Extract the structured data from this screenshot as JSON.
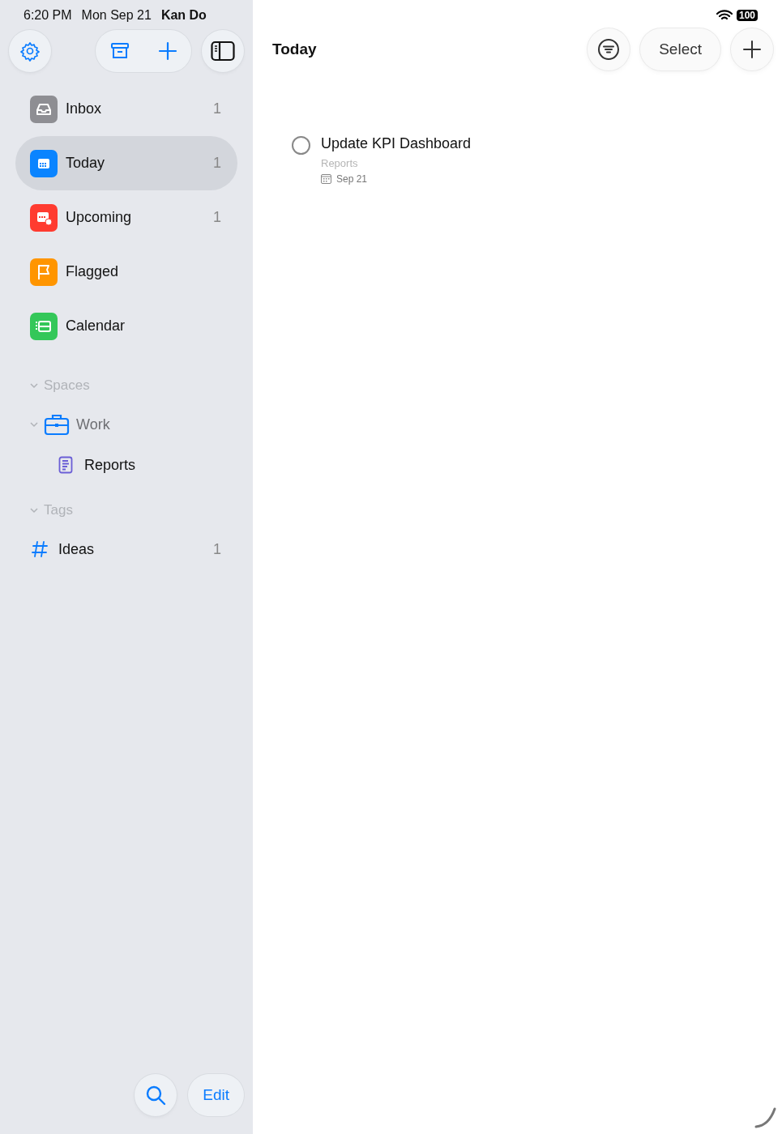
{
  "status_bar": {
    "time": "6:20 PM",
    "date": "Mon Sep 21",
    "app": "Kan Do",
    "battery": "100"
  },
  "sidebar": {
    "smart_lists": [
      {
        "kind": "inbox",
        "label": "Inbox",
        "count": "1",
        "color": "#8e8e93",
        "selected": false
      },
      {
        "kind": "today",
        "label": "Today",
        "count": "1",
        "color": "#0a84ff",
        "selected": true
      },
      {
        "kind": "upcoming",
        "label": "Upcoming",
        "count": "1",
        "color": "#ff3b30",
        "selected": false
      },
      {
        "kind": "flagged",
        "label": "Flagged",
        "color": "#ff9500",
        "selected": false
      },
      {
        "kind": "calendar",
        "label": "Calendar",
        "color": "#34c759",
        "selected": false
      }
    ],
    "spaces": {
      "title": "Spaces",
      "expanded": true,
      "items": [
        {
          "label": "Work",
          "expanded": true,
          "children": [
            {
              "label": "Reports"
            }
          ]
        }
      ]
    },
    "tags": {
      "title": "Tags",
      "expanded": true,
      "items": [
        {
          "label": "Ideas",
          "count": "1"
        }
      ]
    },
    "edit_button": "Edit"
  },
  "main": {
    "title": "Today",
    "select_button": "Select",
    "tasks": [
      {
        "title": "Update KPI Dashboard",
        "list": "Reports",
        "date": "Sep 21",
        "completed": false
      }
    ]
  }
}
